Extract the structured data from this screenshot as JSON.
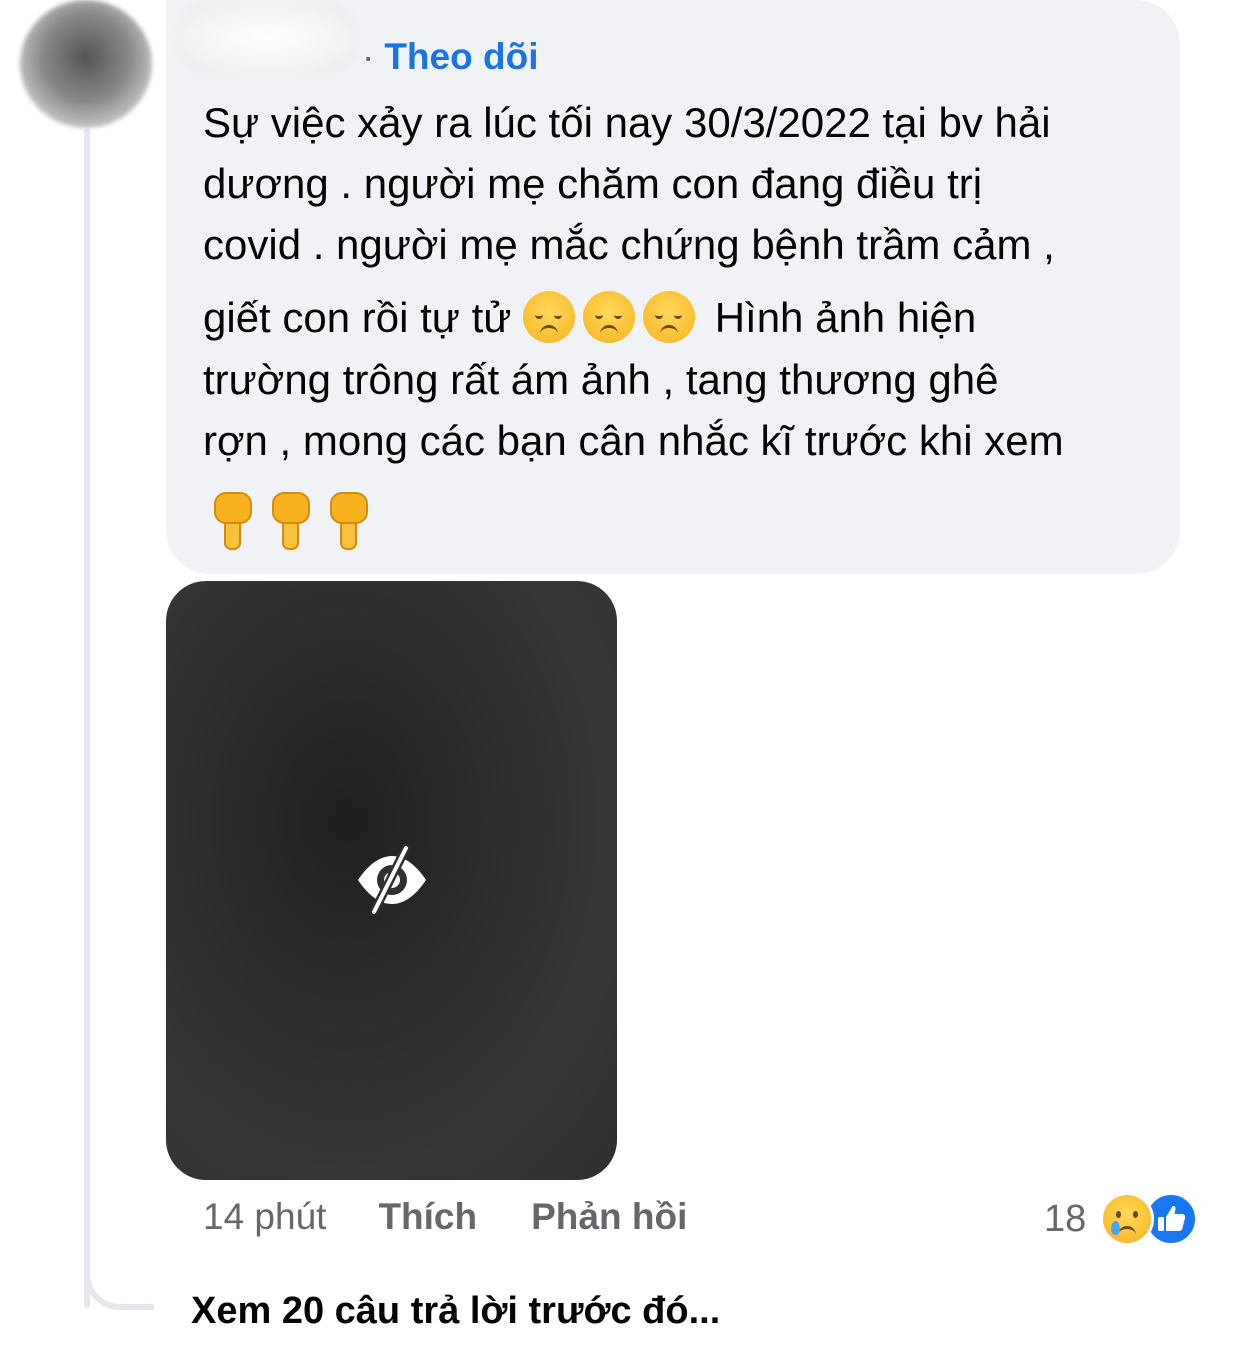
{
  "comment": {
    "author": {
      "follow_label": "Theo dõi",
      "separator": "·"
    },
    "text_lines": [
      "Sự việc xảy ra lúc tối nay 30/3/2022 tại  bv hải",
      "dương .  người mẹ chăm con đang điều trị",
      "covid . người mẹ mắc chứng bệnh trầm cảm ,",
      "giết con rồi tự tử",
      "Hình ảnh hiện",
      "trường trông rất ám ảnh , tang thương ghê",
      "rợn , mong các bạn cân nhắc kĩ trước khi xem"
    ],
    "inline_emojis": [
      "disappointed-face",
      "disappointed-face",
      "disappointed-face"
    ],
    "trailing_emojis": [
      "backhand-index-pointing-down",
      "backhand-index-pointing-down",
      "backhand-index-pointing-down"
    ],
    "media": {
      "hidden_icon": "eye-slash-icon"
    },
    "actions": {
      "time": "14 phút",
      "like_label": "Thích",
      "reply_label": "Phản hồi"
    },
    "reactions": {
      "count": "18",
      "types": [
        "sad",
        "like"
      ]
    }
  },
  "view_previous_replies": "Xem 20 câu trả lời trước đó...",
  "colors": {
    "bubble_bg": "#f0f2f5",
    "link_blue": "#1b74e4",
    "secondary_text": "#65676b",
    "media_bg": "#2d2d2d"
  }
}
